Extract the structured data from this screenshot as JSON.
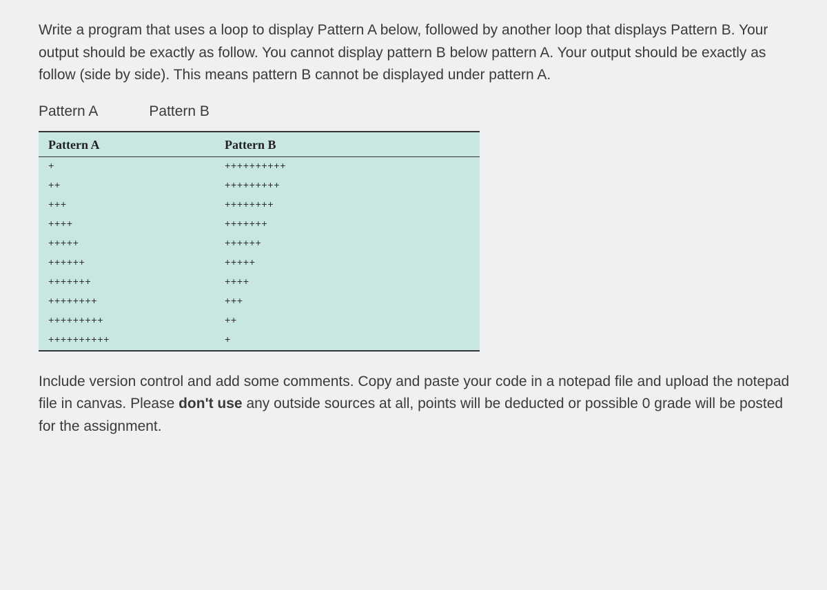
{
  "intro": "Write a program that uses a loop to display Pattern A below, followed by another loop that displays Pattern B. Your output should be exactly as follow. You cannot display pattern B below pattern A. Your output should be exactly as follow (side by side). This means pattern B cannot be displayed under pattern A.",
  "label_a": "Pattern A",
  "label_b": "Pattern B",
  "table": {
    "header_a": "Pattern A",
    "header_b": "Pattern B",
    "rows": [
      {
        "a": "+",
        "b": "++++++++++"
      },
      {
        "a": "++",
        "b": "+++++++++"
      },
      {
        "a": "+++",
        "b": "++++++++"
      },
      {
        "a": "++++",
        "b": "+++++++"
      },
      {
        "a": "+++++",
        "b": "++++++"
      },
      {
        "a": "++++++",
        "b": "+++++"
      },
      {
        "a": "+++++++",
        "b": "++++"
      },
      {
        "a": "++++++++",
        "b": "+++"
      },
      {
        "a": "+++++++++",
        "b": "++"
      },
      {
        "a": "++++++++++",
        "b": "+"
      }
    ]
  },
  "outro_pre": "Include version control and add some comments. Copy and paste your code in a notepad file and upload the notepad file in canvas. Please ",
  "outro_bold": "don't use",
  "outro_post": " any outside sources at all, points will be deducted or possible 0 grade will be posted for the assignment."
}
